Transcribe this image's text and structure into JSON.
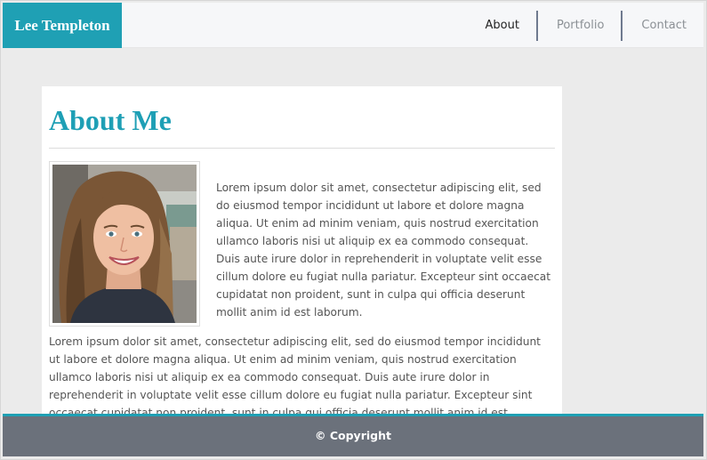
{
  "navbar": {
    "brand": "Lee Templeton",
    "items": [
      {
        "label": "About"
      },
      {
        "label": "Portfolio"
      },
      {
        "label": "Contact"
      }
    ]
  },
  "main": {
    "title": "About Me",
    "photo_alt": "Portrait photo of a smiling woman with long brown hair",
    "paragraphs": [
      "Lorem ipsum dolor sit amet, consectetur adipiscing elit, sed do eiusmod tempor incididunt ut labore et dolore magna aliqua. Ut enim ad minim veniam, quis nostrud exercitation ullamco laboris nisi ut aliquip ex ea commodo consequat. Duis aute irure dolor in reprehenderit in voluptate velit esse cillum dolore eu fugiat nulla pariatur. Excepteur sint occaecat cupidatat non proident, sunt in culpa qui officia deserunt mollit anim id est laborum.",
      "Lorem ipsum dolor sit amet, consectetur adipiscing elit, sed do eiusmod tempor incididunt ut labore et dolore magna aliqua. Ut enim ad minim veniam, quis nostrud exercitation ullamco laboris nisi ut aliquip ex ea commodo consequat. Duis aute irure dolor in reprehenderit in voluptate velit esse cillum dolore eu fugiat nulla pariatur. Excepteur sint occaecat cupidatat non proident, sunt in culpa qui officia deserunt mollit anim id est laborum."
    ]
  },
  "footer": {
    "text": "© Copyright"
  },
  "colors": {
    "accent": "#1fa0b4",
    "footer_bg": "#6b717b",
    "page_bg": "#ebebeb"
  }
}
